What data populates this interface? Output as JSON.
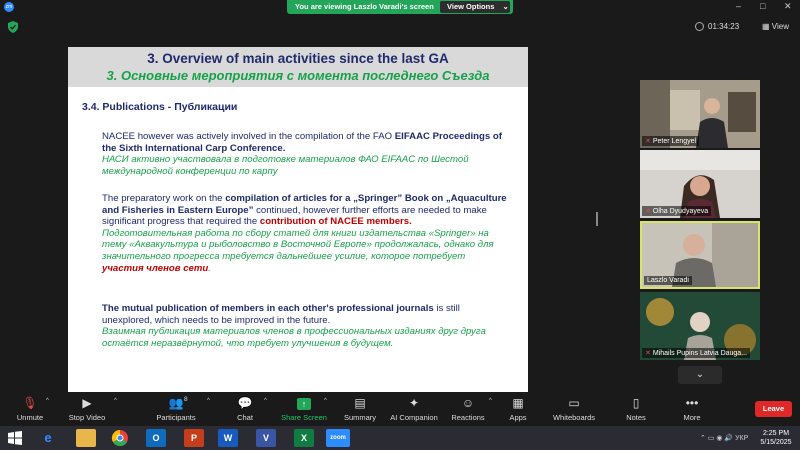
{
  "topbar": {
    "banner_text": "You are viewing Laszlo Varadi's screen",
    "view_options": "View Options",
    "logo": "zm"
  },
  "secondbar": {
    "timer": "01:34:23",
    "view_label": "View"
  },
  "slide": {
    "title_en": "3. Overview of main activities since the last GA",
    "title_ru": "3. Основные мероприятия с момента последнего Съезда",
    "section": "3.4. Publications - Публикации",
    "p1_en_a": "NACEE however was actively involved in the compilation of the FAO ",
    "p1_en_b": "EIFAAC Proceedings of the Sixth International Carp Conference.",
    "p1_ru": "НАСИ активно участвовала в подготовке материалов ФАО EIFAAC по Шестой международной конференции по карпу",
    "p2_en_a": "The preparatory work on the ",
    "p2_en_b": "compilation of articles for a „Springer” Book on „Aquaculture and Fisheries in Eastern Europe”",
    "p2_en_c": " continued, however further efforts are needed to make significant progress that required the ",
    "p2_en_d": "contribution of NACEE members.",
    "p2_ru_a": "Подготовительная работа по сбору статей для книги издательства «Springer» на тему «Аквакультура и рыболовство в Восточной Европе» продолжалась, однако для значительного прогресса требуется дальнейшее усилие, которое потребует ",
    "p2_ru_b": "участия членов сети",
    "p2_ru_c": ".",
    "p3_en_a": "The mutual publication of members in each other's professional journals",
    "p3_en_b": " is still unexplored, which needs to be improved in the future.",
    "p3_ru": "Взаимная публикация материалов членов в профессиональных изданиях друг друга остаётся неразвёрнутой, что требует улучшения в будущем."
  },
  "participants": [
    {
      "name": "Peter Lengyel",
      "active": false
    },
    {
      "name": "Olha Dyudyayeva",
      "active": false
    },
    {
      "name": "Laszlo Varadi",
      "active": true
    },
    {
      "name": "Mihails Pupins Latvia Dauga...",
      "active": false
    }
  ],
  "toolbar": {
    "unmute": "Unmute",
    "stop_video": "Stop Video",
    "participants": "Participants",
    "participants_count": "8",
    "chat": "Chat",
    "share_screen": "Share Screen",
    "summary": "Summary",
    "ai_companion": "AI Companion",
    "reactions": "Reactions",
    "apps": "Apps",
    "whiteboards": "Whiteboards",
    "notes": "Notes",
    "more": "More",
    "leave": "Leave"
  },
  "taskbar": {
    "lang": "УКР",
    "time": "2:25 PM",
    "date": "5/15/2025",
    "zoom_label": "zoom",
    "outlook_label": "O",
    "word_label": "W",
    "excel_label": "X",
    "powerpoint_label": "P",
    "visio_label": "V"
  },
  "colors": {
    "banner": "#23a55a",
    "leave": "#e02828",
    "slide_blue": "#1f2a6b",
    "slide_green": "#17a24a",
    "slide_red": "#c00000",
    "active_tile_border": "#d7e36b"
  }
}
